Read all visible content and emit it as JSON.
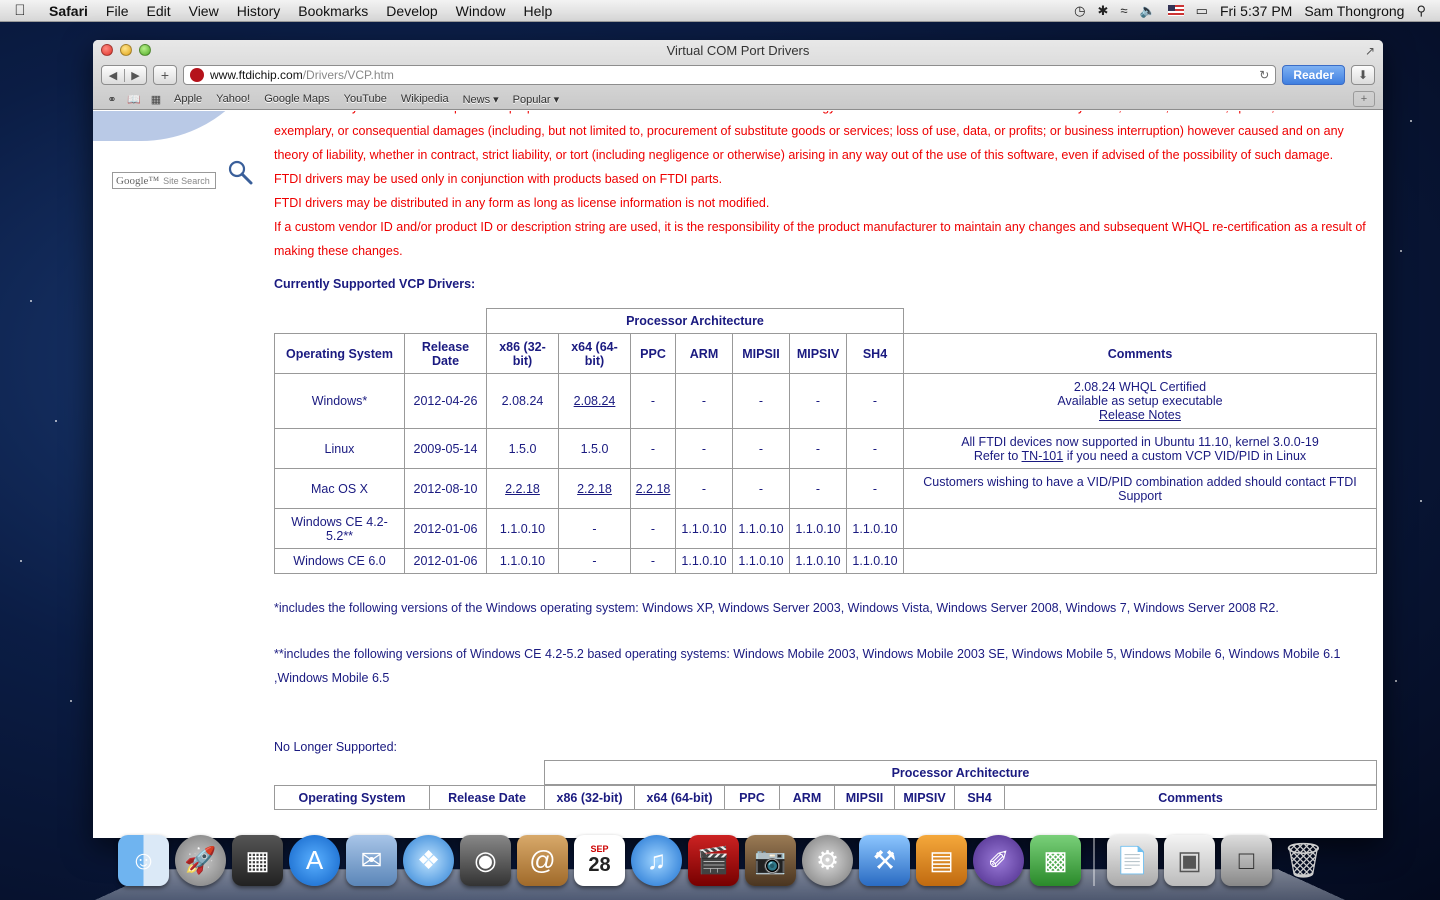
{
  "menubar": {
    "app": "Safari",
    "items": [
      "File",
      "Edit",
      "View",
      "History",
      "Bookmarks",
      "Develop",
      "Window",
      "Help"
    ],
    "clock": "Fri 5:37 PM",
    "user": "Sam Thongrong"
  },
  "window": {
    "title": "Virtual COM Port Drivers",
    "url_host": "www.ftdichip.com",
    "url_path": "/Drivers/VCP.htm",
    "reader_label": "Reader"
  },
  "bookmarks": [
    "Apple",
    "Yahoo!",
    "Google Maps",
    "YouTube",
    "Wikipedia",
    "News ▾",
    "Popular ▾"
  ],
  "sidebar": {
    "search_brand": "Google™",
    "search_placeholder": "Site Search"
  },
  "legal": {
    "line0": "merchantability and fitness for a particular purpose are disclaimed. In no event shall future technology devices international limited be liable for any direct, indirect, incidental, special,",
    "line1": "exemplary, or consequential damages (including, but not limited to, procurement of substitute goods or services; loss of use, data, or profits; or business interruption) however caused and on any theory of liability, whether in contract, strict liability, or tort (including negligence or otherwise) arising in any way out of the use of this software, even if advised of the possibility of such damage.",
    "line2": "FTDI drivers may be used only in conjunction with products based on FTDI parts.",
    "line3": "FTDI drivers may be distributed in any form as long as license information is not modified.",
    "line4": "If a custom vendor ID and/or product ID or description string are used, it is the responsibility of the product manufacturer to maintain any changes and subsequent WHQL re-certification as a result of making these changes."
  },
  "vcp": {
    "section_title": "Currently Supported VCP Drivers:",
    "proc_arch": "Processor Architecture",
    "headers": [
      "Operating System",
      "Release Date",
      "x86 (32-bit)",
      "x64 (64-bit)",
      "PPC",
      "ARM",
      "MIPSII",
      "MIPSIV",
      "SH4",
      "Comments"
    ],
    "rows": [
      {
        "os": "Windows*",
        "date": "2012-04-26",
        "x86": "2.08.24",
        "x64": "2.08.24",
        "ppc": "-",
        "arm": "-",
        "mipsii": "-",
        "mipsiv": "-",
        "sh4": "-",
        "c1": "2.08.24 WHQL Certified",
        "c2": "Available as setup executable",
        "c3": "Release Notes"
      },
      {
        "os": "Linux",
        "date": "2009-05-14",
        "x86": "1.5.0",
        "x64": "1.5.0",
        "ppc": "-",
        "arm": "-",
        "mipsii": "-",
        "mipsiv": "-",
        "sh4": "-",
        "c1": "All FTDI devices now supported in Ubuntu 11.10, kernel 3.0.0-19",
        "c2a": "Refer to ",
        "c2link": "TN-101",
        "c2b": " if you need a custom VCP VID/PID in Linux"
      },
      {
        "os": "Mac OS X",
        "date": "2012-08-10",
        "x86": "2.2.18",
        "x64": "2.2.18",
        "ppc": "2.2.18",
        "arm": "-",
        "mipsii": "-",
        "mipsiv": "-",
        "sh4": "-",
        "c1": "Customers wishing to have a VID/PID combination added should contact FTDI Support"
      },
      {
        "os": "Windows CE 4.2-5.2**",
        "date": "2012-01-06",
        "x86": "1.1.0.10",
        "x64": "-",
        "ppc": "-",
        "arm": "1.1.0.10",
        "mipsii": "1.1.0.10",
        "mipsiv": "1.1.0.10",
        "sh4": "1.1.0.10",
        "c1": ""
      },
      {
        "os": "Windows CE 6.0",
        "date": "2012-01-06",
        "x86": "1.1.0.10",
        "x64": "-",
        "ppc": "-",
        "arm": "1.1.0.10",
        "mipsii": "1.1.0.10",
        "mipsiv": "1.1.0.10",
        "sh4": "1.1.0.10",
        "c1": ""
      }
    ]
  },
  "notes": {
    "n1": "*includes the following versions of the Windows operating system: Windows XP, Windows Server 2003, Windows Vista, Windows Server 2008, Windows 7, Windows Server 2008 R2.",
    "n2": "**includes the following versions of Windows CE 4.2-5.2 based operating systems: Windows Mobile 2003, Windows Mobile 2003 SE, Windows Mobile 5, Windows Mobile 6, Windows Mobile 6.1 ,Windows Mobile 6.5"
  },
  "old": {
    "title": "No Longer Supported:",
    "proc_arch": "Processor Architecture",
    "headers": [
      "Operating System",
      "Release Date",
      "x86 (32-bit)",
      "x64 (64-bit)",
      "PPC",
      "ARM",
      "MIPSII",
      "MIPSIV",
      "SH4",
      "Comments"
    ]
  },
  "dock": {
    "icons": [
      "finder-icon",
      "launchpad-icon",
      "photo-booth-icon",
      "app-store-icon",
      "mail-icon",
      "safari-icon",
      "facetime-icon",
      "address-book-icon",
      "calendar-icon",
      "itunes-icon",
      "movies-icon",
      "iphoto-icon",
      "system-preferences-icon",
      "xcode-icon",
      "keynote-icon",
      "instruments-icon",
      "numbers-icon",
      "documents-stack-icon",
      "screenshot-stack-icon",
      "downloads-stack-icon",
      "trash-icon"
    ],
    "calendar_day": "28",
    "calendar_month": "SEP"
  },
  "colors": {
    "legal_text": "#ee0000",
    "table_text": "#1a1a80",
    "reader_button": "#3f7fe0"
  }
}
